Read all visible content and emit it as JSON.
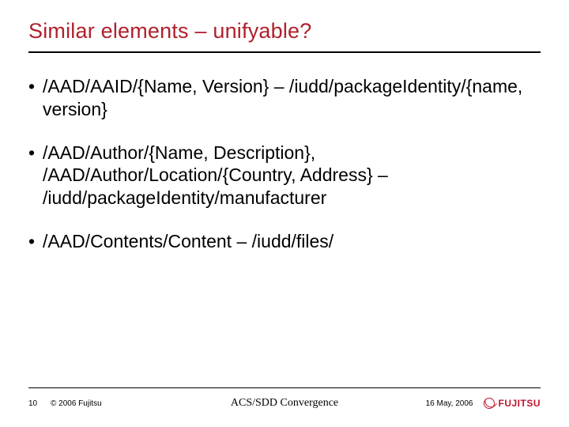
{
  "title": "Similar elements – unifyable?",
  "bullets": [
    "/AAD/AAID/{Name, Version} – /iudd/packageIdentity/{name, version}",
    "/AAD/Author/{Name, Description}, /AAD/Author/Location/{Country, Address} – /iudd/packageIdentity/manufacturer",
    "/AAD/Contents/Content – /iudd/files/"
  ],
  "footer": {
    "page": "10",
    "copyright": "© 2006 Fujitsu",
    "center": "ACS/SDD Convergence",
    "date": "16 May, 2006",
    "logo_text": "FUJITSU"
  }
}
